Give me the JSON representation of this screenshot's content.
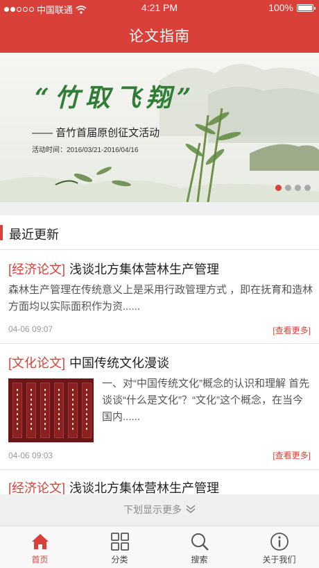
{
  "status_bar": {
    "carrier": "中国联通",
    "time": "4:21 PM",
    "battery": "100%"
  },
  "nav": {
    "title": "论文指南"
  },
  "banner": {
    "title": "“竹取飞翔”",
    "subtitle": "—— 音竹首届原创征文活动",
    "date_text": "活动时间：2016/03/21-2016/04/16",
    "page_count": 4,
    "active_page": 1
  },
  "section": {
    "title": "最近更新"
  },
  "articles": [
    {
      "tag": "[经济论文]",
      "title": "浅谈北方集体营林生产管理",
      "summary": "森林生产管理在传统意义上是采用行政管理方式 ，即在抚育和造林方面均以实际面积作为资......",
      "date": "04-06 09:07",
      "more": "[查看更多]"
    },
    {
      "tag": "[文化论文]",
      "title": "中国传统文化漫谈",
      "summary": " 一、对“中国传统文化”概念的认识和理解 首先谈谈“什么是文化”？“文化”这个概念，在当今国内......",
      "date": "04-06 09:03",
      "more": "[查看更多]"
    },
    {
      "tag": "[经济论文]",
      "title": "浅谈北方集体营林生产管理"
    }
  ],
  "load_more": {
    "label": "下划显示更多"
  },
  "tabs": [
    {
      "label": "首页",
      "icon": "home-icon",
      "active": true
    },
    {
      "label": "分类",
      "icon": "grid-icon",
      "active": false
    },
    {
      "label": "搜索",
      "icon": "search-icon",
      "active": false
    },
    {
      "label": "关于我们",
      "icon": "info-icon",
      "active": false
    }
  ],
  "colors": {
    "accent": "#d9403a",
    "banner_green": "#2f7d36"
  }
}
